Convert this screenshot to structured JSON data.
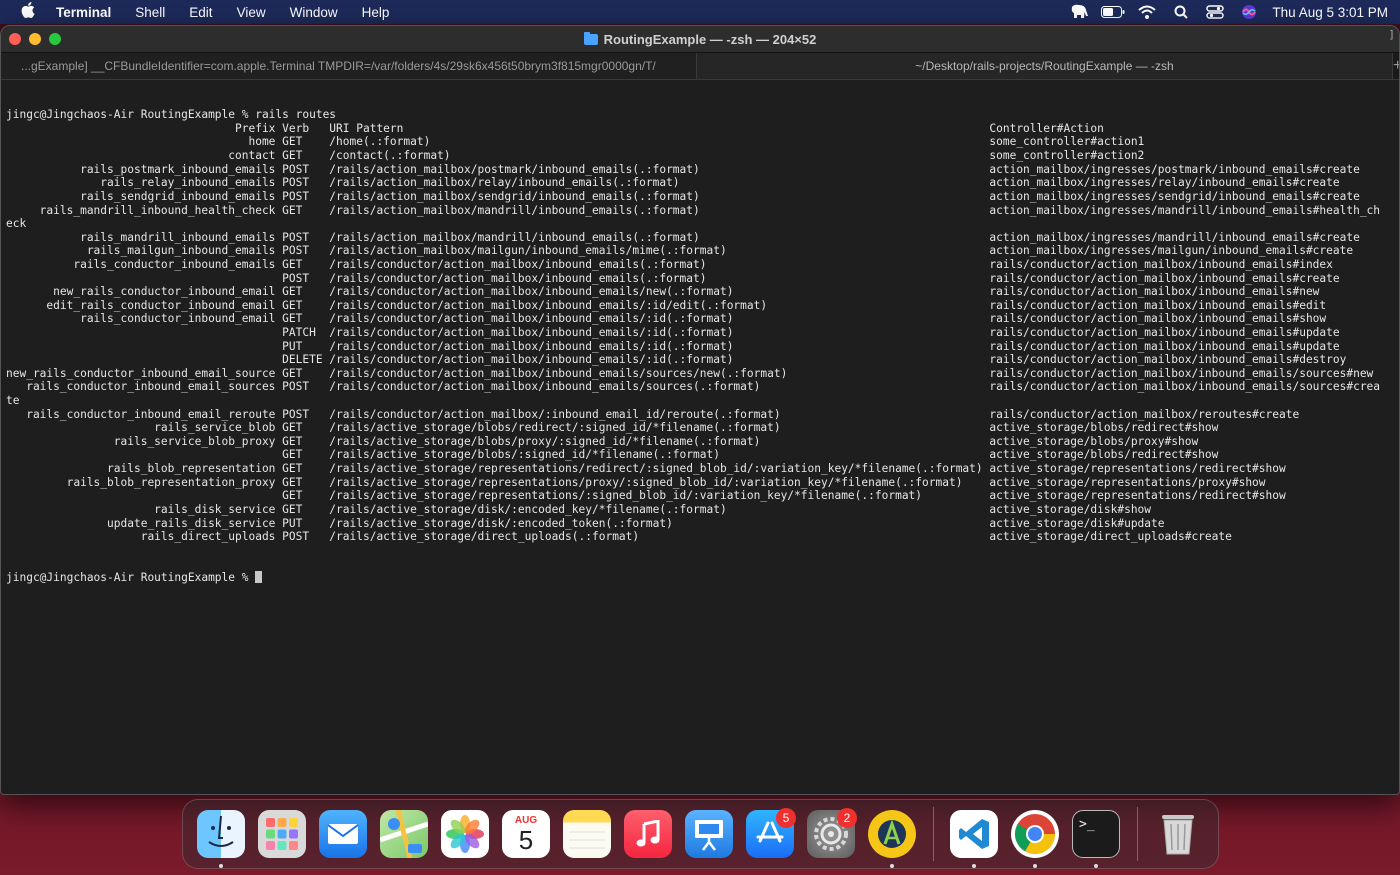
{
  "menubar": {
    "app_name": "Terminal",
    "menus": [
      "Shell",
      "Edit",
      "View",
      "Window",
      "Help"
    ],
    "clock": "Thu Aug 5  3:01 PM"
  },
  "window": {
    "title": "RoutingExample — -zsh — 204×52",
    "tabs": [
      "...gExample] __CFBundleIdentifier=com.apple.Terminal TMPDIR=/var/folders/4s/29sk6x456t50brym3f815mgr0000gn/T/",
      "~/Desktop/rails-projects/RoutingExample — -zsh"
    ],
    "add_tab": "+"
  },
  "terminal": {
    "lines": [
      "jingc@Jingchaos-Air RoutingExample % rails routes",
      "                                  Prefix Verb   URI Pattern                                                                                       Controller#Action",
      "                                    home GET    /home(.:format)                                                                                   some_controller#action1",
      "                                 contact GET    /contact(.:format)                                                                                some_controller#action2",
      "           rails_postmark_inbound_emails POST   /rails/action_mailbox/postmark/inbound_emails(.:format)                                           action_mailbox/ingresses/postmark/inbound_emails#create",
      "              rails_relay_inbound_emails POST   /rails/action_mailbox/relay/inbound_emails(.:format)                                              action_mailbox/ingresses/relay/inbound_emails#create",
      "           rails_sendgrid_inbound_emails POST   /rails/action_mailbox/sendgrid/inbound_emails(.:format)                                           action_mailbox/ingresses/sendgrid/inbound_emails#create",
      "     rails_mandrill_inbound_health_check GET    /rails/action_mailbox/mandrill/inbound_emails(.:format)                                           action_mailbox/ingresses/mandrill/inbound_emails#health_ch",
      "eck",
      "           rails_mandrill_inbound_emails POST   /rails/action_mailbox/mandrill/inbound_emails(.:format)                                           action_mailbox/ingresses/mandrill/inbound_emails#create",
      "            rails_mailgun_inbound_emails POST   /rails/action_mailbox/mailgun/inbound_emails/mime(.:format)                                       action_mailbox/ingresses/mailgun/inbound_emails#create",
      "          rails_conductor_inbound_emails GET    /rails/conductor/action_mailbox/inbound_emails(.:format)                                          rails/conductor/action_mailbox/inbound_emails#index",
      "                                         POST   /rails/conductor/action_mailbox/inbound_emails(.:format)                                          rails/conductor/action_mailbox/inbound_emails#create",
      "       new_rails_conductor_inbound_email GET    /rails/conductor/action_mailbox/inbound_emails/new(.:format)                                      rails/conductor/action_mailbox/inbound_emails#new",
      "      edit_rails_conductor_inbound_email GET    /rails/conductor/action_mailbox/inbound_emails/:id/edit(.:format)                                 rails/conductor/action_mailbox/inbound_emails#edit",
      "           rails_conductor_inbound_email GET    /rails/conductor/action_mailbox/inbound_emails/:id(.:format)                                      rails/conductor/action_mailbox/inbound_emails#show",
      "                                         PATCH  /rails/conductor/action_mailbox/inbound_emails/:id(.:format)                                      rails/conductor/action_mailbox/inbound_emails#update",
      "                                         PUT    /rails/conductor/action_mailbox/inbound_emails/:id(.:format)                                      rails/conductor/action_mailbox/inbound_emails#update",
      "                                         DELETE /rails/conductor/action_mailbox/inbound_emails/:id(.:format)                                      rails/conductor/action_mailbox/inbound_emails#destroy",
      "new_rails_conductor_inbound_email_source GET    /rails/conductor/action_mailbox/inbound_emails/sources/new(.:format)                              rails/conductor/action_mailbox/inbound_emails/sources#new",
      "   rails_conductor_inbound_email_sources POST   /rails/conductor/action_mailbox/inbound_emails/sources(.:format)                                  rails/conductor/action_mailbox/inbound_emails/sources#crea",
      "te",
      "   rails_conductor_inbound_email_reroute POST   /rails/conductor/action_mailbox/:inbound_email_id/reroute(.:format)                               rails/conductor/action_mailbox/reroutes#create",
      "                      rails_service_blob GET    /rails/active_storage/blobs/redirect/:signed_id/*filename(.:format)                               active_storage/blobs/redirect#show",
      "                rails_service_blob_proxy GET    /rails/active_storage/blobs/proxy/:signed_id/*filename(.:format)                                  active_storage/blobs/proxy#show",
      "                                         GET    /rails/active_storage/blobs/:signed_id/*filename(.:format)                                        active_storage/blobs/redirect#show",
      "               rails_blob_representation GET    /rails/active_storage/representations/redirect/:signed_blob_id/:variation_key/*filename(.:format) active_storage/representations/redirect#show",
      "         rails_blob_representation_proxy GET    /rails/active_storage/representations/proxy/:signed_blob_id/:variation_key/*filename(.:format)    active_storage/representations/proxy#show",
      "                                         GET    /rails/active_storage/representations/:signed_blob_id/:variation_key/*filename(.:format)          active_storage/representations/redirect#show",
      "                      rails_disk_service GET    /rails/active_storage/disk/:encoded_key/*filename(.:format)                                       active_storage/disk#show",
      "               update_rails_disk_service PUT    /rails/active_storage/disk/:encoded_token(.:format)                                               active_storage/disk#update",
      "                    rails_direct_uploads POST   /rails/active_storage/direct_uploads(.:format)                                                    active_storage/direct_uploads#create"
    ],
    "prompt": "jingc@Jingchaos-Air RoutingExample % "
  },
  "dock": {
    "calendar_month": "AUG",
    "calendar_day": "5",
    "app_store_badge": "5",
    "settings_badge": "2",
    "terminal_glyph": ">_"
  }
}
